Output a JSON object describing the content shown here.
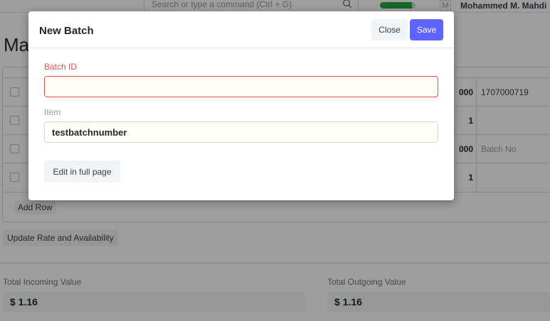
{
  "topbar": {
    "search_placeholder": "Search or type a command (Ctrl + G)",
    "progress_fraction": 0.9,
    "avatar_initial": "M",
    "user_name": "Mohammed M. Mahdi"
  },
  "page": {
    "title_partial": "Ma"
  },
  "items_table": {
    "rows": [
      {
        "qty": "000",
        "batch": "1707000719"
      },
      {
        "qty": "1",
        "batch": ""
      },
      {
        "qty": "000",
        "batch": "Batch No"
      },
      {
        "qty": "1",
        "batch": ""
      }
    ],
    "add_row_label": "Add Row"
  },
  "actions": {
    "update_rate_label": "Update Rate and Availability"
  },
  "totals": {
    "incoming_label": "Total Incoming Value",
    "incoming_value": "$ 1.16",
    "outgoing_label": "Total Outgoing Value",
    "outgoing_value": "$ 1.16"
  },
  "modal": {
    "title": "New Batch",
    "close_label": "Close",
    "save_label": "Save",
    "batch_id_label": "Batch ID",
    "batch_id_value": "",
    "item_label": "Item",
    "item_value": "testbatchnumber",
    "full_page_label": "Edit in full page"
  },
  "colors": {
    "primary": "#5e64ff",
    "error": "#e24c4c",
    "progress": "#28a745"
  }
}
